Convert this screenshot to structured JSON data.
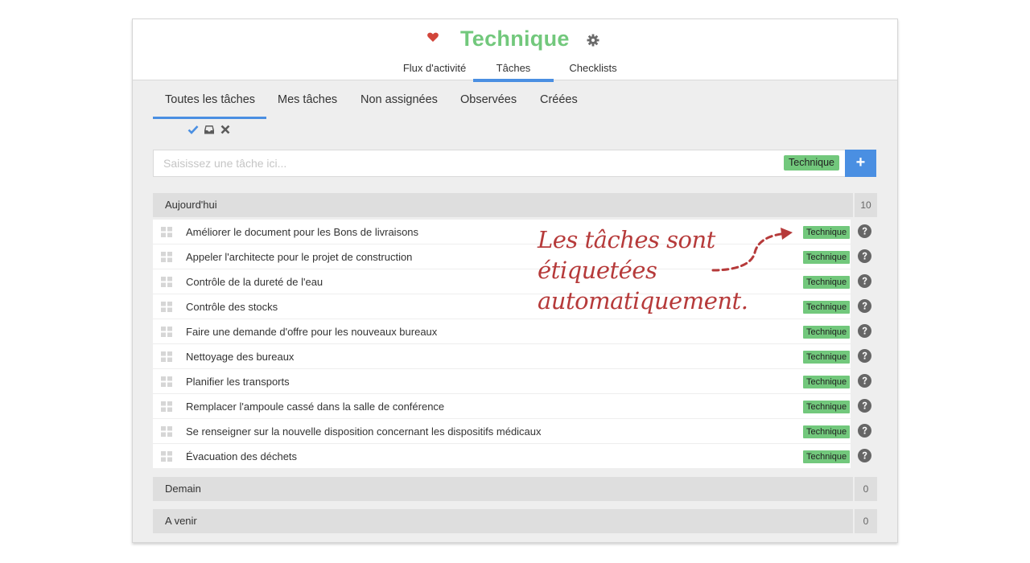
{
  "header": {
    "title": "Technique",
    "icons": {
      "favorite": "heart-icon",
      "settings": "gear-icon"
    },
    "tabs": [
      {
        "label": "Flux d'activité",
        "active": false
      },
      {
        "label": "Tâches",
        "active": true
      },
      {
        "label": "Checklists",
        "active": false
      }
    ]
  },
  "subtabs": [
    {
      "label": "Toutes les tâches",
      "active": true
    },
    {
      "label": "Mes tâches",
      "active": false
    },
    {
      "label": "Non assignées",
      "active": false
    },
    {
      "label": "Observées",
      "active": false
    },
    {
      "label": "Créées",
      "active": false
    }
  ],
  "filter_icons": [
    "check-icon",
    "inbox-icon",
    "close-icon"
  ],
  "task_input": {
    "placeholder": "Saisissez une tâche ici...",
    "value": "",
    "tag": "Technique",
    "add_label": "+"
  },
  "groups": {
    "today": {
      "label": "Aujourd'hui",
      "count": "10"
    },
    "tomorrow": {
      "label": "Demain",
      "count": "0"
    },
    "upcoming": {
      "label": "A venir",
      "count": "0"
    }
  },
  "tasks": [
    {
      "label": "Améliorer le document pour les Bons de livraisons",
      "tag": "Technique"
    },
    {
      "label": "Appeler l'architecte pour le projet de construction",
      "tag": "Technique"
    },
    {
      "label": "Contrôle de la dureté de l'eau",
      "tag": "Technique"
    },
    {
      "label": "Contrôle des stocks",
      "tag": "Technique"
    },
    {
      "label": "Faire une demande d'offre pour les nouveaux bureaux",
      "tag": "Technique"
    },
    {
      "label": "Nettoyage des bureaux",
      "tag": "Technique"
    },
    {
      "label": "Planifier les transports",
      "tag": "Technique"
    },
    {
      "label": "Remplacer l'ampoule cassé dans la salle de conférence",
      "tag": "Technique"
    },
    {
      "label": "Se renseigner sur la nouvelle disposition concernant les dispositifs médicaux",
      "tag": "Technique"
    },
    {
      "label": "Évacuation des déchets",
      "tag": "Technique"
    }
  ],
  "annotation": {
    "lines": [
      "Les tâches sont",
      "étiquetées",
      "automatiquement."
    ]
  },
  "colors": {
    "accent": "#4a8fe2",
    "tag_green": "#72c87c",
    "title_green": "#72c87c",
    "heart": "#d2453a",
    "annotation": "#b63a3a"
  }
}
